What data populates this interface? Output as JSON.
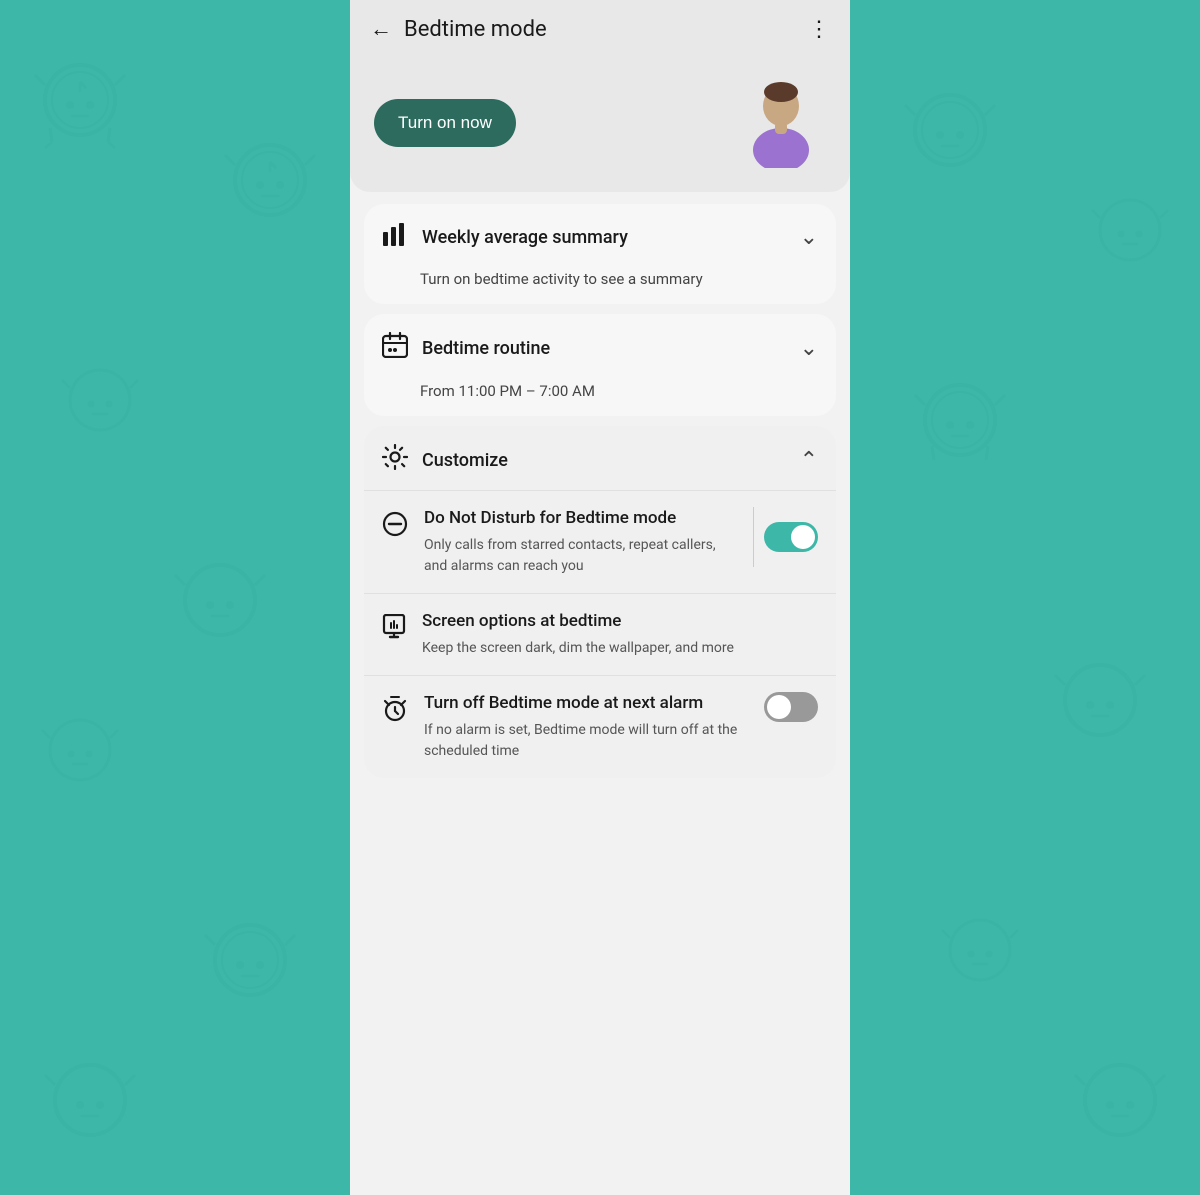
{
  "background": {
    "color": "#3db8a8"
  },
  "header": {
    "back_label": "←",
    "title": "Bedtime mode",
    "menu_label": "⋮"
  },
  "hero": {
    "turn_on_label": "Turn on now"
  },
  "weekly_summary": {
    "title": "Weekly average summary",
    "subtitle": "Turn on bedtime activity to see a summary",
    "chevron": "∨"
  },
  "bedtime_routine": {
    "title": "Bedtime routine",
    "subtitle": "From 11:00 PM – 7:00 AM",
    "chevron": "∨"
  },
  "customize": {
    "title": "Customize",
    "chevron": "∧",
    "items": [
      {
        "id": "dnd",
        "title": "Do Not Disturb for Bedtime mode",
        "description": "Only calls from starred contacts, repeat callers, and alarms can reach you",
        "toggle": true,
        "toggle_state": "on"
      },
      {
        "id": "screen",
        "title": "Screen options at bedtime",
        "description": "Keep the screen dark, dim the wallpaper, and more",
        "toggle": false
      },
      {
        "id": "alarm",
        "title": "Turn off Bedtime mode at next alarm",
        "description": "If no alarm is set, Bedtime mode will turn off at the scheduled time",
        "toggle": true,
        "toggle_state": "off"
      }
    ]
  }
}
